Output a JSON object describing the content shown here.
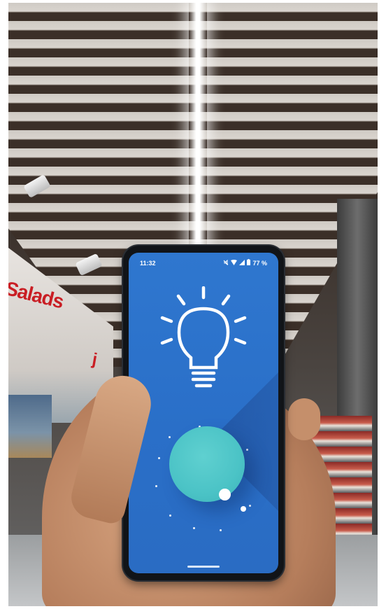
{
  "scene": {
    "store_sign_main": "Salads",
    "store_sign_secondary": "j"
  },
  "phone": {
    "status_bar": {
      "time": "11:32",
      "battery_percent": "77 %"
    },
    "app": {
      "icon_name": "lightbulb-icon",
      "orb_icon_name": "planet-with-moons-icon",
      "background_color": "#2f77cf",
      "orb_color": "#4bc3c6"
    }
  }
}
